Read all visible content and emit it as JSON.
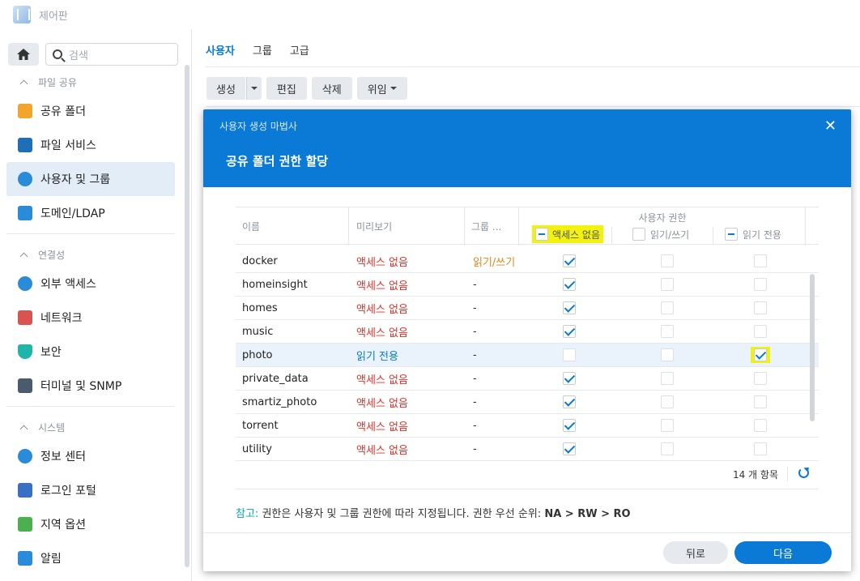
{
  "app": {
    "title": "제어판"
  },
  "search": {
    "placeholder": "검색"
  },
  "sidebar": {
    "sections": [
      {
        "label": "파일 공유",
        "items": [
          {
            "label": "공유 폴더",
            "icon": "folder-icon",
            "color": "#f2a42c"
          },
          {
            "label": "파일 서비스",
            "icon": "file-services-icon",
            "color": "#1f6fb8"
          },
          {
            "label": "사용자 및 그룹",
            "icon": "users-icon",
            "color": "#2a8bd8",
            "active": true
          },
          {
            "label": "도메인/LDAP",
            "icon": "domain-icon",
            "color": "#2a8bd8"
          }
        ]
      },
      {
        "label": "연결성",
        "items": [
          {
            "label": "외부 액세스",
            "icon": "external-access-icon",
            "color": "#2a8bd8"
          },
          {
            "label": "네트워크",
            "icon": "network-house-icon",
            "color": "#d9534f"
          },
          {
            "label": "보안",
            "icon": "shield-icon",
            "color": "#1fb5a8"
          },
          {
            "label": "터미널 및 SNMP",
            "icon": "terminal-icon",
            "color": "#4b5b6e"
          }
        ]
      },
      {
        "label": "시스템",
        "items": [
          {
            "label": "정보 센터",
            "icon": "info-icon",
            "color": "#2a8bd8"
          },
          {
            "label": "로그인 포털",
            "icon": "login-portal-icon",
            "color": "#3a6fc4"
          },
          {
            "label": "지역 옵션",
            "icon": "region-icon",
            "color": "#4caf50"
          },
          {
            "label": "알림",
            "icon": "notification-icon",
            "color": "#2a8bd8"
          }
        ]
      }
    ]
  },
  "tabs": [
    {
      "label": "사용자",
      "active": true
    },
    {
      "label": "그룹"
    },
    {
      "label": "고급"
    }
  ],
  "toolbar": {
    "create": "생성",
    "edit": "편집",
    "delete": "삭제",
    "delegate": "위임"
  },
  "dialog": {
    "wizard_title": "사용자 생성 마법사",
    "step_title": "공유 폴더 권한 할당",
    "columns": {
      "name": "이름",
      "preview": "미리보기",
      "group": "그룹 ...",
      "user_perm": "사용자 권한",
      "no_access": "액세스 없음",
      "read_write": "읽기/쓰기",
      "read_only": "읽기 전용"
    },
    "rows": [
      {
        "name": "docker",
        "preview": "액세스 없음",
        "preview_color": "red",
        "group": "읽기/쓰기",
        "group_color": "orange",
        "na": true,
        "rw": false,
        "ro": false
      },
      {
        "name": "homeinsight",
        "preview": "액세스 없음",
        "preview_color": "red",
        "group": "-",
        "group_color": "dark",
        "na": true,
        "rw": false,
        "ro": false
      },
      {
        "name": "homes",
        "preview": "액세스 없음",
        "preview_color": "red",
        "group": "-",
        "group_color": "dark",
        "na": true,
        "rw": false,
        "ro": false
      },
      {
        "name": "music",
        "preview": "액세스 없음",
        "preview_color": "red",
        "group": "-",
        "group_color": "dark",
        "na": true,
        "rw": false,
        "ro": false
      },
      {
        "name": "photo",
        "preview": "읽기 전용",
        "preview_color": "blue",
        "group": "-",
        "group_color": "dark",
        "na": false,
        "rw": false,
        "ro": true,
        "selected": true
      },
      {
        "name": "private_data",
        "preview": "액세스 없음",
        "preview_color": "red",
        "group": "-",
        "group_color": "dark",
        "na": true,
        "rw": false,
        "ro": false
      },
      {
        "name": "smartiz_photo",
        "preview": "액세스 없음",
        "preview_color": "red",
        "group": "-",
        "group_color": "dark",
        "na": true,
        "rw": false,
        "ro": false
      },
      {
        "name": "torrent",
        "preview": "액세스 없음",
        "preview_color": "red",
        "group": "-",
        "group_color": "dark",
        "na": true,
        "rw": false,
        "ro": false
      },
      {
        "name": "utility",
        "preview": "액세스 없음",
        "preview_color": "red",
        "group": "-",
        "group_color": "dark",
        "na": true,
        "rw": false,
        "ro": false
      }
    ],
    "item_count": "14 개 항목",
    "note_label": "참고:",
    "note_text": "권한은 사용자 및 그룹 권한에 따라 지정됩니다. 권한 우선 순위:",
    "note_priority": "NA > RW > RO",
    "back": "뒤로",
    "next": "다음"
  },
  "colors": {
    "accent": "#0a7ad6",
    "no_access": "#e0312a",
    "highlight": "#f2f20e"
  }
}
